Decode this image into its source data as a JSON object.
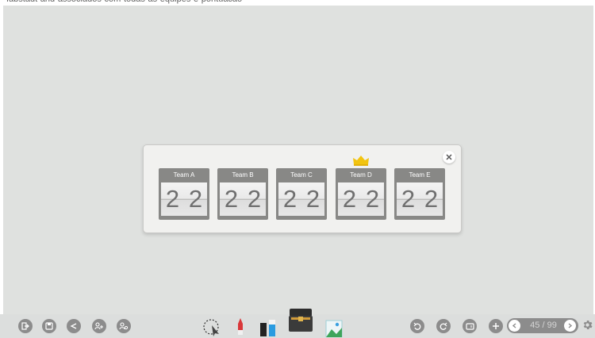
{
  "header": {
    "partial_text": "fabstadt-and-associados-com-todas-as-equipes-e-pontuacao"
  },
  "scoreboard": {
    "teams": [
      {
        "name": "Team A",
        "digits": [
          "2",
          "2"
        ],
        "leader": false
      },
      {
        "name": "Team B",
        "digits": [
          "2",
          "2"
        ],
        "leader": false
      },
      {
        "name": "Team C",
        "digits": [
          "2",
          "2"
        ],
        "leader": false
      },
      {
        "name": "Team D",
        "digits": [
          "2",
          "2"
        ],
        "leader": true
      },
      {
        "name": "Team E",
        "digits": [
          "2",
          "2"
        ],
        "leader": false
      }
    ],
    "crown_color": "#f2c40f"
  },
  "toolbar": {
    "left_icons": [
      "exit-icon",
      "save-icon",
      "share-icon",
      "add-user-icon",
      "user-settings-icon"
    ],
    "center_tools": [
      "select-tool",
      "pen-tool",
      "eraser-tool",
      "toolbox-tool",
      "image-tool"
    ],
    "right_icons": [
      "undo-icon",
      "redo-icon",
      "screen-icon",
      "add-page-icon"
    ],
    "pager": {
      "current": "45",
      "separator": "/",
      "total": "99",
      "text": "45 / 99"
    }
  },
  "colors": {
    "canvas": "#dfe1df",
    "dock": "#dcdedd",
    "button": "#8c8c8c",
    "tile": "#888886"
  }
}
